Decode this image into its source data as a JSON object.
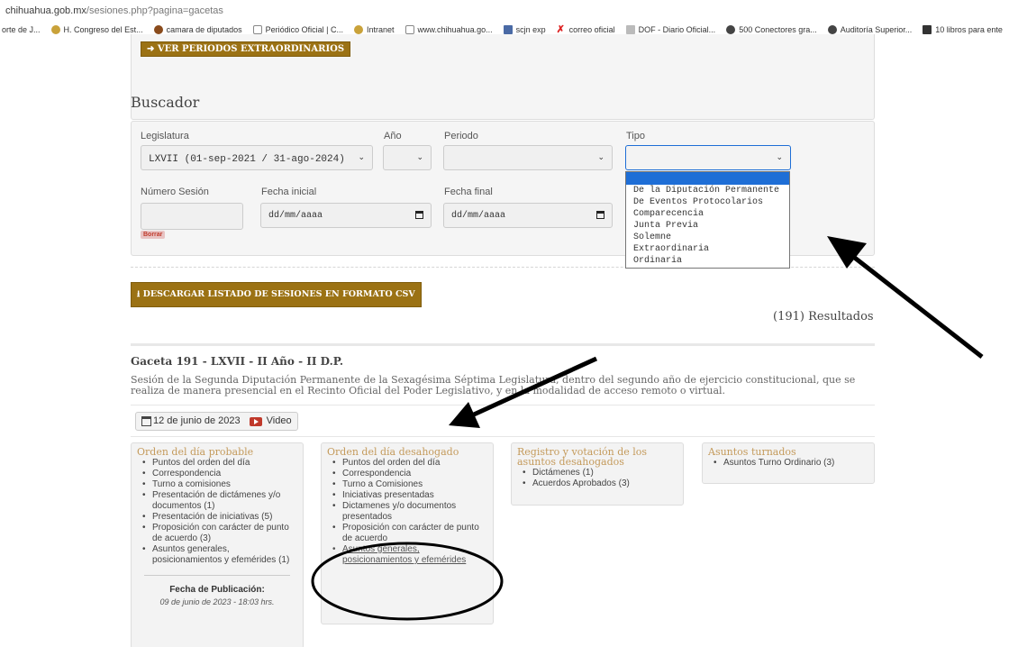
{
  "browser": {
    "url_host": "chihuahua.gob.mx",
    "url_path": "/sesiones.php?pagina=gacetas",
    "bookmarks": [
      {
        "label": "orte de J...",
        "icon": "none"
      },
      {
        "label": "H. Congreso del Est...",
        "icon": "congress-icon"
      },
      {
        "label": "camara de diputados",
        "icon": "camara-icon"
      },
      {
        "label": "Periódico Oficial | C...",
        "icon": "shield-icon"
      },
      {
        "label": "Intranet",
        "icon": "congress-icon"
      },
      {
        "label": "www.chihuahua.go...",
        "icon": "shield-icon"
      },
      {
        "label": "scjn exp",
        "icon": "scjn-icon"
      },
      {
        "label": "correo oficial",
        "icon": "x-icon"
      },
      {
        "label": "DOF - Diario Oficial...",
        "icon": "dof-icon"
      },
      {
        "label": "500 Conectores gra...",
        "icon": "globe-icon"
      },
      {
        "label": "Auditoría Superior...",
        "icon": "globe-icon"
      },
      {
        "label": "10 libros para ente",
        "icon": "book-icon"
      }
    ]
  },
  "page": {
    "btn_periodos": "VER PERIODOS EXTRAORDINARIOS",
    "buscador_title": "Buscador",
    "filters": {
      "legislatura_label": "Legislatura",
      "legislatura_value": "LXVII (01-sep-2021 / 31-ago-2024)",
      "anio_label": "Año",
      "periodo_label": "Periodo",
      "tipo_label": "Tipo",
      "numero_label": "Número Sesión",
      "fecha_inicial_label": "Fecha inicial",
      "fecha_inicial_placeholder": "dd/mm/aaaa",
      "fecha_final_label": "Fecha final",
      "fecha_final_placeholder": "dd/mm/aaaa",
      "borrar": "Borrar"
    },
    "tipo_options": [
      "De la Diputación Permanente",
      "De Eventos Protocolarios",
      "Comparecencia",
      "Junta Previa",
      "Solemne",
      "Extraordinaria",
      "Ordinaria"
    ],
    "btn_csv": "DESCARGAR LISTADO DE SESIONES EN FORMATO CSV",
    "resultados": "(191) Resultados",
    "gaceta": {
      "title": "Gaceta 191 - LXVII - II Año - II D.P.",
      "description": "Sesión de la Segunda Diputación Permanente de la Sexagésima Séptima Legislatura, dentro del segundo año de ejercicio constitucional, que se realiza de manera presencial en el Recinto Oficial del Poder Legislativo, y en la modalidad de acceso remoto o virtual.",
      "date": "12 de junio de 2023",
      "video": "Video"
    },
    "cards": {
      "probable": {
        "title": "Orden del día probable",
        "items": [
          "Puntos del orden del día",
          "Correspondencia",
          "Turno a comisiones",
          "Presentación de dictámenes y/o documentos (1)",
          "Presentación de iniciativas (5)",
          "Proposición con carácter de punto de acuerdo (3)",
          "Asuntos generales, posicionamientos y efemérides (1)"
        ],
        "pub_label": "Fecha de Publicación:",
        "pub_date": "09 de junio de 2023 - 18:03 hrs."
      },
      "desahogado": {
        "title": "Orden del día desahogado",
        "items": [
          "Puntos del orden del día",
          "Correspondencia",
          "Turno a Comisiones",
          "Iniciativas presentadas",
          "Dictamenes y/o documentos presentados",
          "Proposición con carácter de punto de acuerdo",
          "Asuntos generales, posicionamientos y efemérides"
        ]
      },
      "registro": {
        "title": "Registro y votación de los asuntos desahogados",
        "items": [
          "Dictámenes (1)",
          "Acuerdos Aprobados (3)"
        ]
      },
      "turnados": {
        "title": "Asuntos turnados",
        "items": [
          "Asuntos Turno Ordinario (3)"
        ]
      }
    }
  },
  "colors": {
    "gold_button": "#9b7214",
    "card_title": "#c49a5b",
    "selected_option": "#1e6ed6",
    "video_red": "#c0392b"
  }
}
